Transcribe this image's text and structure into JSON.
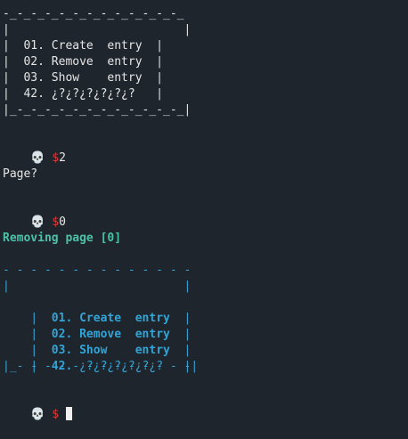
{
  "menu1": {
    "top": "-_-_-_-_-_-_-_-_-_-_-_-_-_",
    "blank": "|                         |",
    "items": [
      "|  01. Create  entry  |",
      "|  02. Remove  entry  |",
      "|  03. Show    entry  |",
      "|  42. ¿?¿?¿?¿?¿?¿?   |"
    ],
    "bottom": "|_-_-_-_-_-_-_-_-_-_-_-_-_|"
  },
  "prompt_icon": "💀",
  "prompt1": {
    "dollar": "$",
    "input": "2"
  },
  "page_question": "Page?",
  "prompt2": {
    "dollar": "$",
    "input": "0"
  },
  "removing_msg": "Removing page [0]",
  "menu2": {
    "top": "- - - - - - - - - - - - - -",
    "blank": "|                         |",
    "items": [
      {
        "bar_l": "|  ",
        "num": "01.",
        "text": " Create  entry",
        "bar_r": "  |"
      },
      {
        "bar_l": "|  ",
        "num": "02.",
        "text": " Remove  entry",
        "bar_r": "  |"
      },
      {
        "bar_l": "|  ",
        "num": "03.",
        "text": " Show    entry",
        "bar_r": "  |"
      },
      {
        "bar_l": "|  ",
        "num": "42.",
        "text": " ¿?¿?¿?¿?¿?¿?",
        "bar_r": "   |"
      }
    ],
    "bottom": "|_- - - - - - - - - - - - -|"
  },
  "prompt3": {
    "dollar": "$",
    "input": ""
  }
}
